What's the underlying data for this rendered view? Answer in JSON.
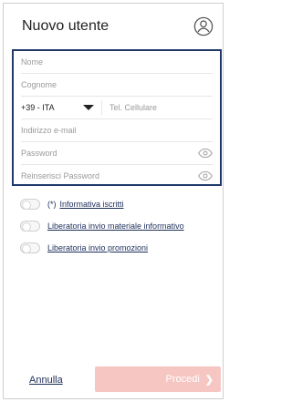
{
  "header": {
    "title": "Nuovo utente",
    "icon": "user-circle-icon"
  },
  "form": {
    "name_placeholder": "Nome",
    "surname_placeholder": "Cognome",
    "phone_prefix": "+39 - ITA",
    "phone_placeholder": "Tel. Cellulare",
    "email_placeholder": "Indirizzo e-mail",
    "password_placeholder": "Password",
    "password_confirm_placeholder": "Reinserisci Password"
  },
  "toggles": [
    {
      "prefix": "(*)",
      "label": "Informativa iscritti"
    },
    {
      "prefix": "",
      "label": "Liberatoria invio materiale informativo"
    },
    {
      "prefix": "",
      "label": "Liberatoria invio promozioni"
    }
  ],
  "footer": {
    "cancel_label": "Annulla",
    "proceed_label": "Procedi"
  },
  "colors": {
    "border_focus": "#1f3a6b",
    "link": "#1c2e5a",
    "proceed_bg": "#f6c7c2"
  }
}
